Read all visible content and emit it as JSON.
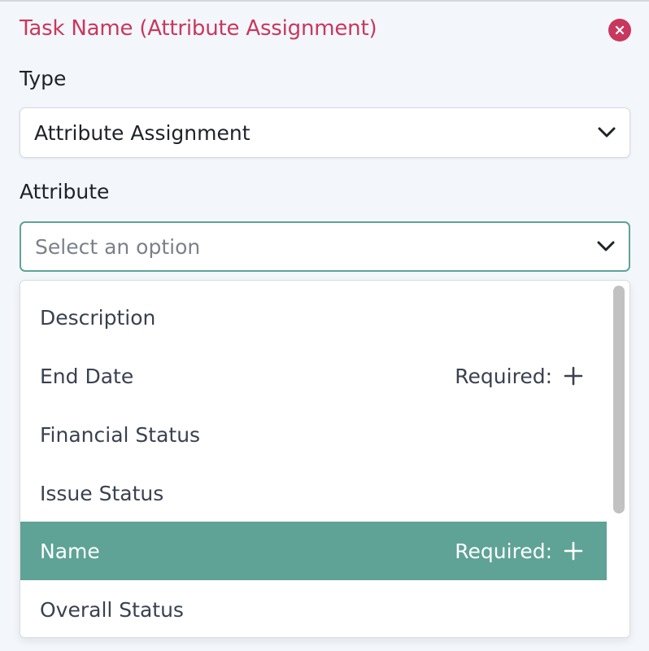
{
  "header": {
    "title": "Task Name (Attribute Assignment)",
    "close_icon": "close-icon",
    "accent_color": "#c8385e"
  },
  "type_field": {
    "label": "Type",
    "value": "Attribute Assignment"
  },
  "attribute_field": {
    "label": "Attribute",
    "placeholder": "Select an option"
  },
  "dropdown": {
    "highlight_color": "#5ea396",
    "options": [
      {
        "label": "Description",
        "required": ""
      },
      {
        "label": "End Date",
        "required": "Required:"
      },
      {
        "label": "Financial Status",
        "required": ""
      },
      {
        "label": "Issue Status",
        "required": ""
      },
      {
        "label": "Name",
        "required": "Required:"
      },
      {
        "label": "Overall Status",
        "required": ""
      }
    ]
  }
}
